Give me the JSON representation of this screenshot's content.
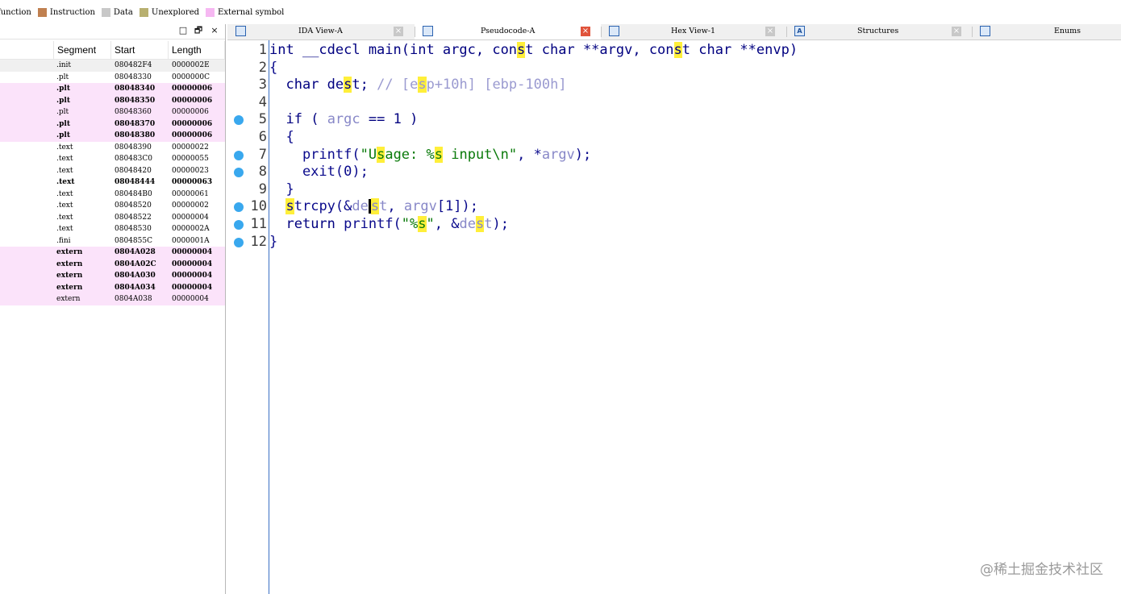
{
  "legend": [
    {
      "label": "function",
      "color": ""
    },
    {
      "label": "Instruction",
      "color": "#c08050"
    },
    {
      "label": "Data",
      "color": "#c8c8c8"
    },
    {
      "label": "Unexplored",
      "color": "#b8b070"
    },
    {
      "label": "External symbol",
      "color": "#f6b8f2"
    }
  ],
  "segments": {
    "window_buttons": [
      "□",
      "🗗",
      "×"
    ],
    "columns": [
      "Segment",
      "Start",
      "Length"
    ],
    "rows": [
      {
        "name": ".init",
        "start": "080482F4",
        "length": "0000002E",
        "style": "grey"
      },
      {
        "name": ".plt",
        "start": "08048330",
        "length": "0000000C",
        "style": ""
      },
      {
        "name": ".plt",
        "start": "08048340",
        "length": "00000006",
        "style": "pink bold"
      },
      {
        "name": ".plt",
        "start": "08048350",
        "length": "00000006",
        "style": "pink bold"
      },
      {
        "name": ".plt",
        "start": "08048360",
        "length": "00000006",
        "style": "pink"
      },
      {
        "name": ".plt",
        "start": "08048370",
        "length": "00000006",
        "style": "pink bold"
      },
      {
        "name": ".plt",
        "start": "08048380",
        "length": "00000006",
        "style": "pink bold"
      },
      {
        "name": ".text",
        "start": "08048390",
        "length": "00000022",
        "style": ""
      },
      {
        "name": ".text",
        "start": "080483C0",
        "length": "00000055",
        "style": ""
      },
      {
        "name": ".text",
        "start": "08048420",
        "length": "00000023",
        "style": ""
      },
      {
        "name": ".text",
        "start": "08048444",
        "length": "00000063",
        "style": "bold"
      },
      {
        "name": ".text",
        "start": "080484B0",
        "length": "00000061",
        "style": ""
      },
      {
        "name": ".text",
        "start": "08048520",
        "length": "00000002",
        "style": ""
      },
      {
        "name": ".text",
        "start": "08048522",
        "length": "00000004",
        "style": ""
      },
      {
        "name": ".text",
        "start": "08048530",
        "length": "0000002A",
        "style": ""
      },
      {
        "name": ".fini",
        "start": "0804855C",
        "length": "0000001A",
        "style": ""
      },
      {
        "name": "extern",
        "start": "0804A028",
        "length": "00000004",
        "style": "pink bold"
      },
      {
        "name": "extern",
        "start": "0804A02C",
        "length": "00000004",
        "style": "pink bold"
      },
      {
        "name": "extern",
        "start": "0804A030",
        "length": "00000004",
        "style": "pink bold"
      },
      {
        "name": "extern",
        "start": "0804A034",
        "length": "00000004",
        "style": "pink bold"
      },
      {
        "name": "extern",
        "start": "0804A038",
        "length": "00000004",
        "style": "pink"
      }
    ]
  },
  "tabs": [
    {
      "label": "IDA View-A",
      "icon": "graph-icon",
      "active": false
    },
    {
      "label": "Pseudocode-A",
      "icon": "code-icon",
      "active": true
    },
    {
      "label": "Hex View-1",
      "icon": "hex-icon",
      "active": false
    },
    {
      "label": "Structures",
      "icon": "structures-icon",
      "active": false
    },
    {
      "label": "Enums",
      "icon": "enums-icon",
      "active": false
    }
  ],
  "code": {
    "lines": [
      {
        "n": "1",
        "bp": false,
        "html": "<span class='kw'>int __cdecl main(int argc, con<span class='hl'>s</span>t char **argv, con<span class='hl'>s</span>t char **envp)</span>"
      },
      {
        "n": "2",
        "bp": false,
        "html": "{"
      },
      {
        "n": "3",
        "bp": false,
        "html": "  <span class='kw'>char de<span class='hl'>s</span>t;</span> <span class='cmt'>// [e<span class='hl'>s</span>p+10h] [ebp-100h]</span>"
      },
      {
        "n": "4",
        "bp": false,
        "html": ""
      },
      {
        "n": "5",
        "bp": true,
        "html": "  <span class='kw'>if (</span> <span class='var'>argc</span> <span class='kw'>== 1 )</span>"
      },
      {
        "n": "6",
        "bp": false,
        "html": "  {"
      },
      {
        "n": "7",
        "bp": true,
        "html": "    printf(<span class='str'>\"U<span class='hl'>s</span>age: %<span class='hl'>s</span> input\\n\"</span>, *<span class='var'>argv</span>);"
      },
      {
        "n": "8",
        "bp": true,
        "html": "    exit(0);"
      },
      {
        "n": "9",
        "bp": false,
        "html": "  }"
      },
      {
        "n": "10",
        "bp": true,
        "html": "  <span class='hl'>s</span>trcpy(&amp;<span class='var'>de</span><span class='cursor'></span><span class='var'><span class='hl'>s</span>t</span>, <span class='var'>argv</span>[1]);"
      },
      {
        "n": "11",
        "bp": true,
        "html": "  <span class='kw'>return</span> printf(<span class='str'>\"%<span class='hl'>s</span>\"</span>, &amp;<span class='var'>de<span class='hl'>s</span>t</span>);"
      },
      {
        "n": "12",
        "bp": true,
        "html": "}"
      }
    ]
  },
  "watermark": "@稀土掘金技术社区"
}
